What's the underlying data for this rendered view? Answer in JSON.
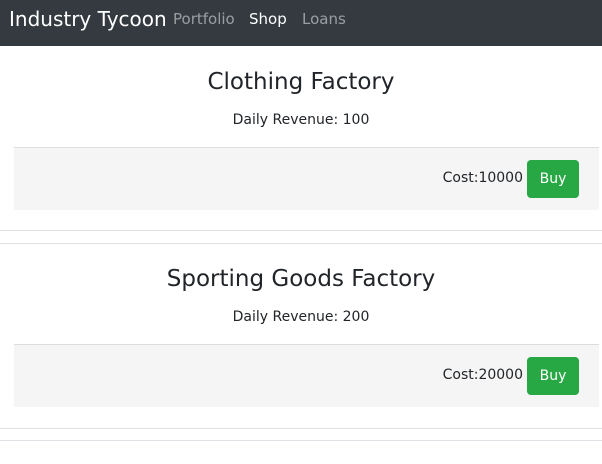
{
  "navbar": {
    "brand": "Industry Tycoon",
    "links": [
      {
        "label": "Portfolio",
        "active": false
      },
      {
        "label": "Shop",
        "active": true
      },
      {
        "label": "Loans",
        "active": false
      }
    ]
  },
  "shop": {
    "items": [
      {
        "name": "Clothing Factory",
        "revenue_text": "Daily Revenue: 100",
        "cost_text": "Cost:10000",
        "buy_label": "Buy"
      },
      {
        "name": "Sporting Goods Factory",
        "revenue_text": "Daily Revenue: 200",
        "cost_text": "Cost:20000",
        "buy_label": "Buy"
      }
    ]
  },
  "colors": {
    "navbar_bg": "#343a40",
    "buy_button": "#28a745",
    "footer_bg": "#f5f5f5"
  }
}
